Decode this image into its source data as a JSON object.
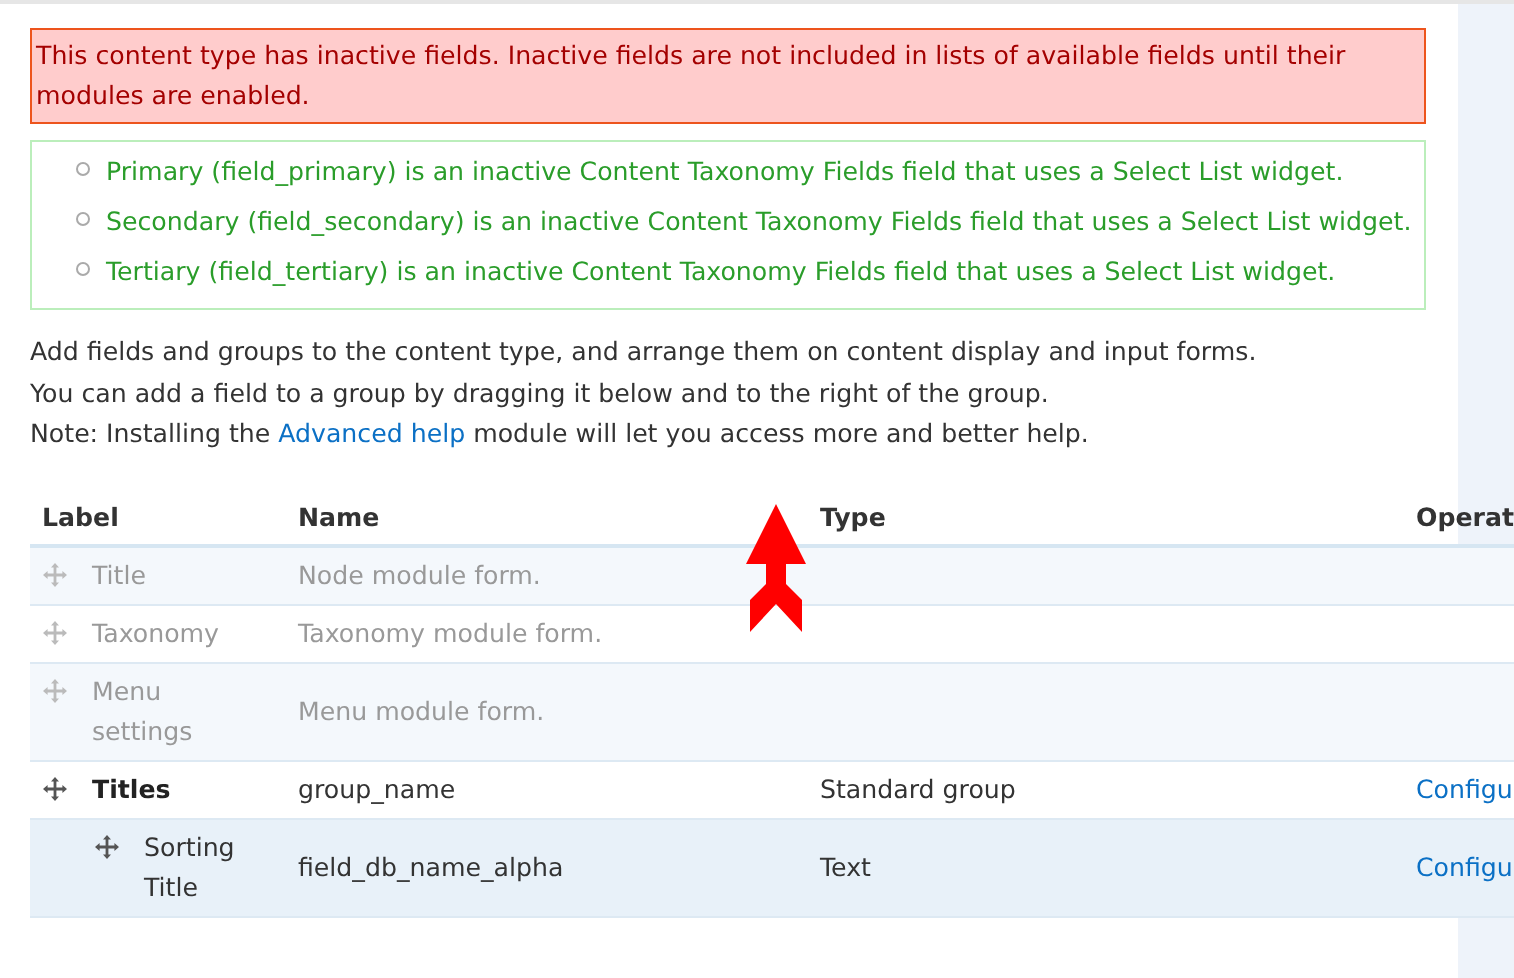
{
  "error_message": "This content type has inactive fields. Inactive fields are not included in lists of available fields until their modules are enabled.",
  "inactive_fields": [
    "Primary (field_primary) is an inactive Content Taxonomy Fields field that uses a Select List widget.",
    "Secondary (field_secondary) is an inactive Content Taxonomy Fields field that uses a Select List widget.",
    "Tertiary (field_tertiary) is an inactive Content Taxonomy Fields field that uses a Select List widget."
  ],
  "help_lines": [
    {
      "text": "Add fields and groups to the content type, and arrange them on content display and input forms."
    },
    {
      "text": "You can add a field to a group by dragging it below and to the right of the group."
    },
    {
      "before": "Note: Installing the ",
      "link": "Advanced help",
      "after": " module will let you access more and better help."
    }
  ],
  "table": {
    "columns": [
      "Label",
      "Name",
      "Type",
      "Operat"
    ],
    "rows": [
      {
        "kind": "module",
        "label": "Title",
        "name": "Node module form."
      },
      {
        "kind": "module",
        "label": "Taxonomy",
        "name": "Taxonomy module form."
      },
      {
        "kind": "module",
        "label": "Menu settings",
        "name": "Menu module form."
      },
      {
        "kind": "group",
        "label": "Titles",
        "name": "group_name",
        "type": "Standard group",
        "operation": "Configu",
        "children": [
          {
            "kind": "field",
            "label": "Sorting Title",
            "name": "field_db_name_alpha",
            "type": "Text",
            "operation": "Configu"
          }
        ]
      }
    ]
  }
}
